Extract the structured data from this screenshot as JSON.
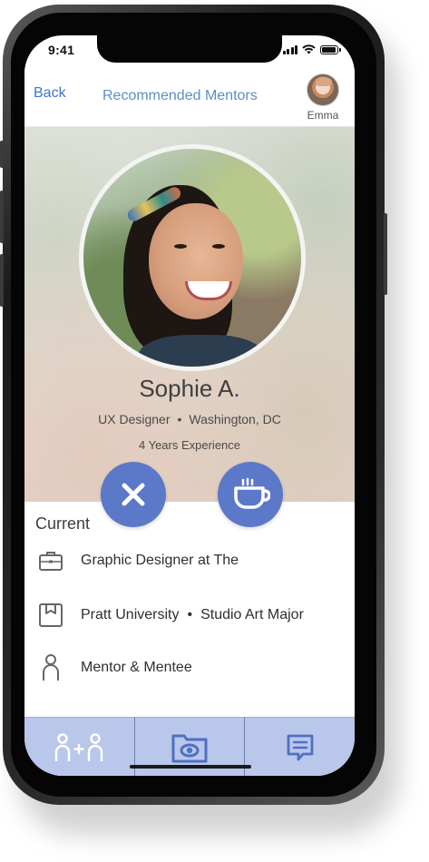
{
  "status_bar": {
    "time": "9:41"
  },
  "header": {
    "back_label": "Back",
    "title": "Recommended Mentors",
    "user_name": "Emma"
  },
  "profile": {
    "name": "Sophie A.",
    "role": "UX Designer",
    "separator": "•",
    "location": "Washington, DC",
    "experience": "4 Years Experience"
  },
  "details": {
    "section_label": "Current",
    "job": "Graphic Designer at The",
    "school": "Pratt University",
    "major": "Studio Art Major",
    "relationship": "Mentor & Mentee"
  },
  "tabs": [
    "mentors-tab",
    "camera-tab",
    "messages-tab"
  ],
  "colors": {
    "accent": "#5b78c9",
    "tabbar": "#b8c7ea",
    "link": "#3a77c9",
    "title": "#5b8ec6"
  }
}
